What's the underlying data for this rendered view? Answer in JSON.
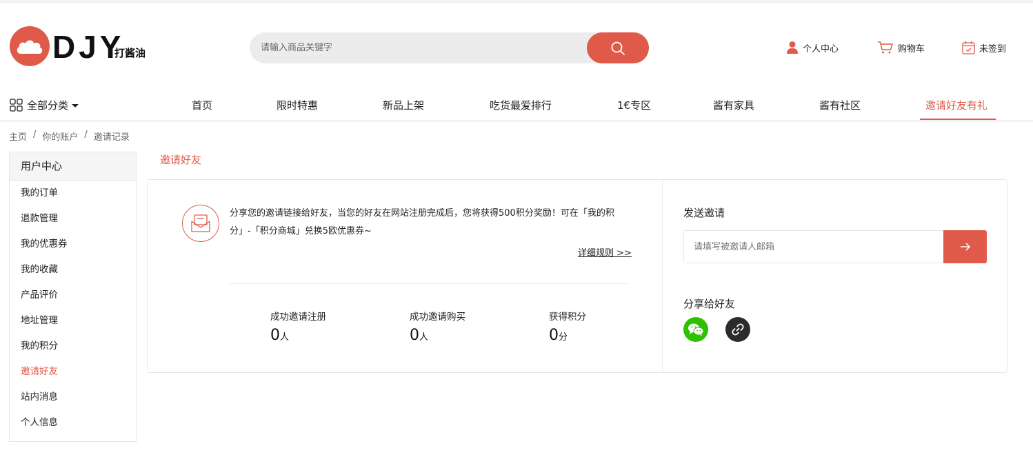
{
  "brand": {
    "name": "DJY",
    "subtitle": "打酱油",
    "accent_color": "#e05a49"
  },
  "search": {
    "placeholder": "请输入商品关键字",
    "icon": "search-icon"
  },
  "header_links": [
    {
      "label": "个人中心",
      "icon": "user-icon"
    },
    {
      "label": "购物车",
      "icon": "cart-icon"
    },
    {
      "label": "未签到",
      "icon": "calendar-check-icon"
    }
  ],
  "nav": {
    "all_categories": "全部分类",
    "items": [
      {
        "label": "首页"
      },
      {
        "label": "限时特惠"
      },
      {
        "label": "新品上架"
      },
      {
        "label": "吃货最爱排行"
      },
      {
        "label": "1€专区"
      },
      {
        "label": "酱有家具"
      },
      {
        "label": "酱有社区"
      },
      {
        "label": "邀请好友有礼",
        "active": true
      }
    ]
  },
  "breadcrumb": [
    "主页",
    "你的账户",
    "邀请记录"
  ],
  "breadcrumb_separator": "/",
  "sidebar": {
    "title": "用户中心",
    "items": [
      {
        "label": "我的订单"
      },
      {
        "label": "退款管理"
      },
      {
        "label": "我的优惠券"
      },
      {
        "label": "我的收藏"
      },
      {
        "label": "产品评价"
      },
      {
        "label": "地址管理"
      },
      {
        "label": "我的积分"
      },
      {
        "label": "邀请好友",
        "active": true
      },
      {
        "label": "站内消息"
      },
      {
        "label": "个人信息"
      }
    ]
  },
  "main": {
    "title": "邀请好友",
    "description": "分享您的邀请链接给好友，当您的好友在网站注册完成后，您将获得500积分奖励！可在「我的积分」-「积分商城」兑换5欧优惠券~",
    "rules_link": "详细规则 >>",
    "stats": [
      {
        "label": "成功邀请注册",
        "value": "0",
        "unit": "人"
      },
      {
        "label": "成功邀请购买",
        "value": "0",
        "unit": "人"
      },
      {
        "label": "获得积分",
        "value": "0",
        "unit": "分"
      }
    ],
    "send_invite": {
      "title": "发送邀请",
      "placeholder": "请填写被邀请人邮箱"
    },
    "share": {
      "title": "分享给好友",
      "buttons": [
        {
          "icon": "wechat-icon",
          "color": "#2dc100"
        },
        {
          "icon": "link-icon",
          "color": "#2b2b2b"
        }
      ]
    }
  }
}
